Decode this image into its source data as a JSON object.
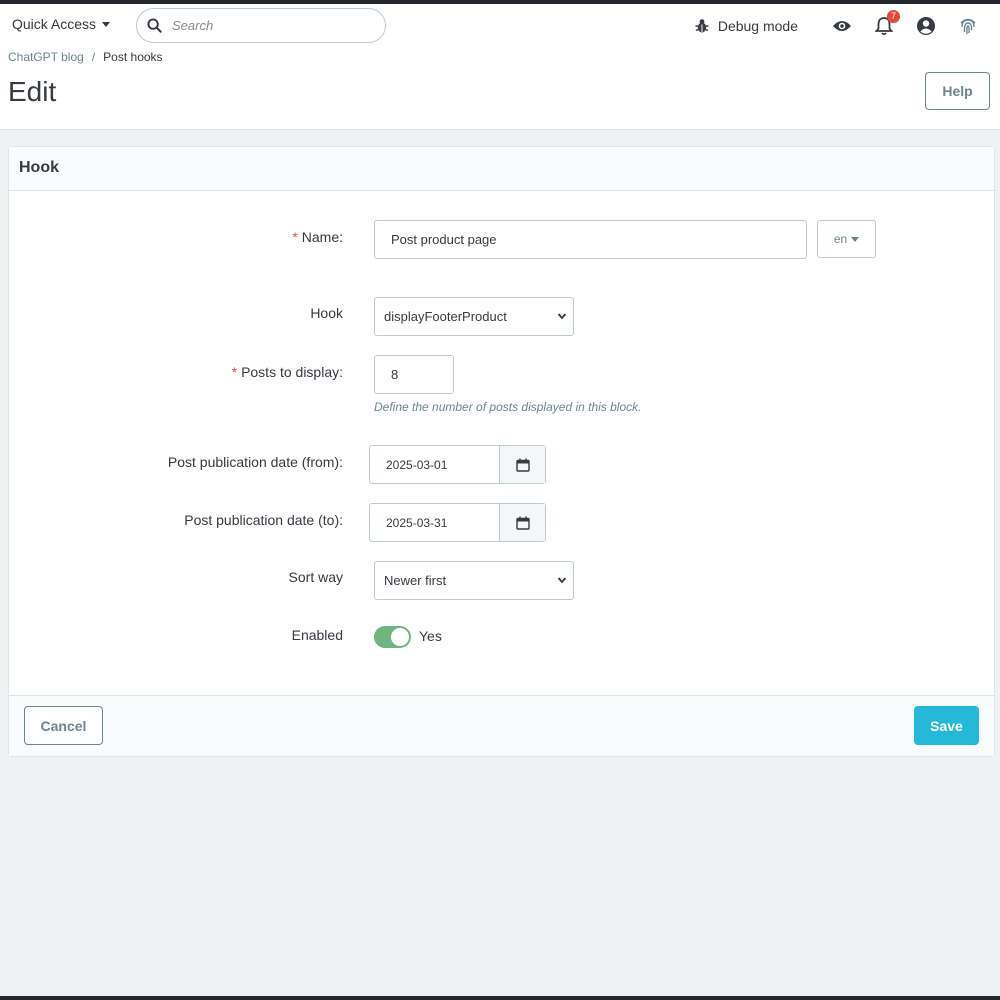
{
  "header": {
    "quick_access": "Quick Access",
    "search_placeholder": "Search",
    "debug_mode": "Debug mode",
    "notifications_count": "7",
    "icons": [
      "bug-icon",
      "eye-icon",
      "bell-icon",
      "user-icon",
      "fingerprint-icon"
    ]
  },
  "breadcrumb": {
    "parent": "ChatGPT blog",
    "separator": "/",
    "current": "Post hooks"
  },
  "page": {
    "title": "Edit",
    "help_label": "Help"
  },
  "form": {
    "section_title": "Hook",
    "required_marker": "*",
    "name": {
      "label": "Name:",
      "value": "Post product page",
      "lang": "en"
    },
    "hook": {
      "label": "Hook",
      "value": "displayFooterProduct"
    },
    "posts": {
      "label": "Posts to display:",
      "value": "8",
      "hint": "Define the number of posts displayed in this block."
    },
    "date_from": {
      "label": "Post publication date (from):",
      "value": "2025-03-01"
    },
    "date_to": {
      "label": "Post publication date (to):",
      "value": "2025-03-31"
    },
    "sort": {
      "label": "Sort way",
      "value": "Newer first"
    },
    "enabled": {
      "label": "Enabled",
      "value": "Yes",
      "on": true
    }
  },
  "actions": {
    "cancel": "Cancel",
    "save": "Save"
  },
  "colors": {
    "accent": "#25b9d7",
    "toggle_on": "#70b580",
    "required": "#e24a3b"
  }
}
